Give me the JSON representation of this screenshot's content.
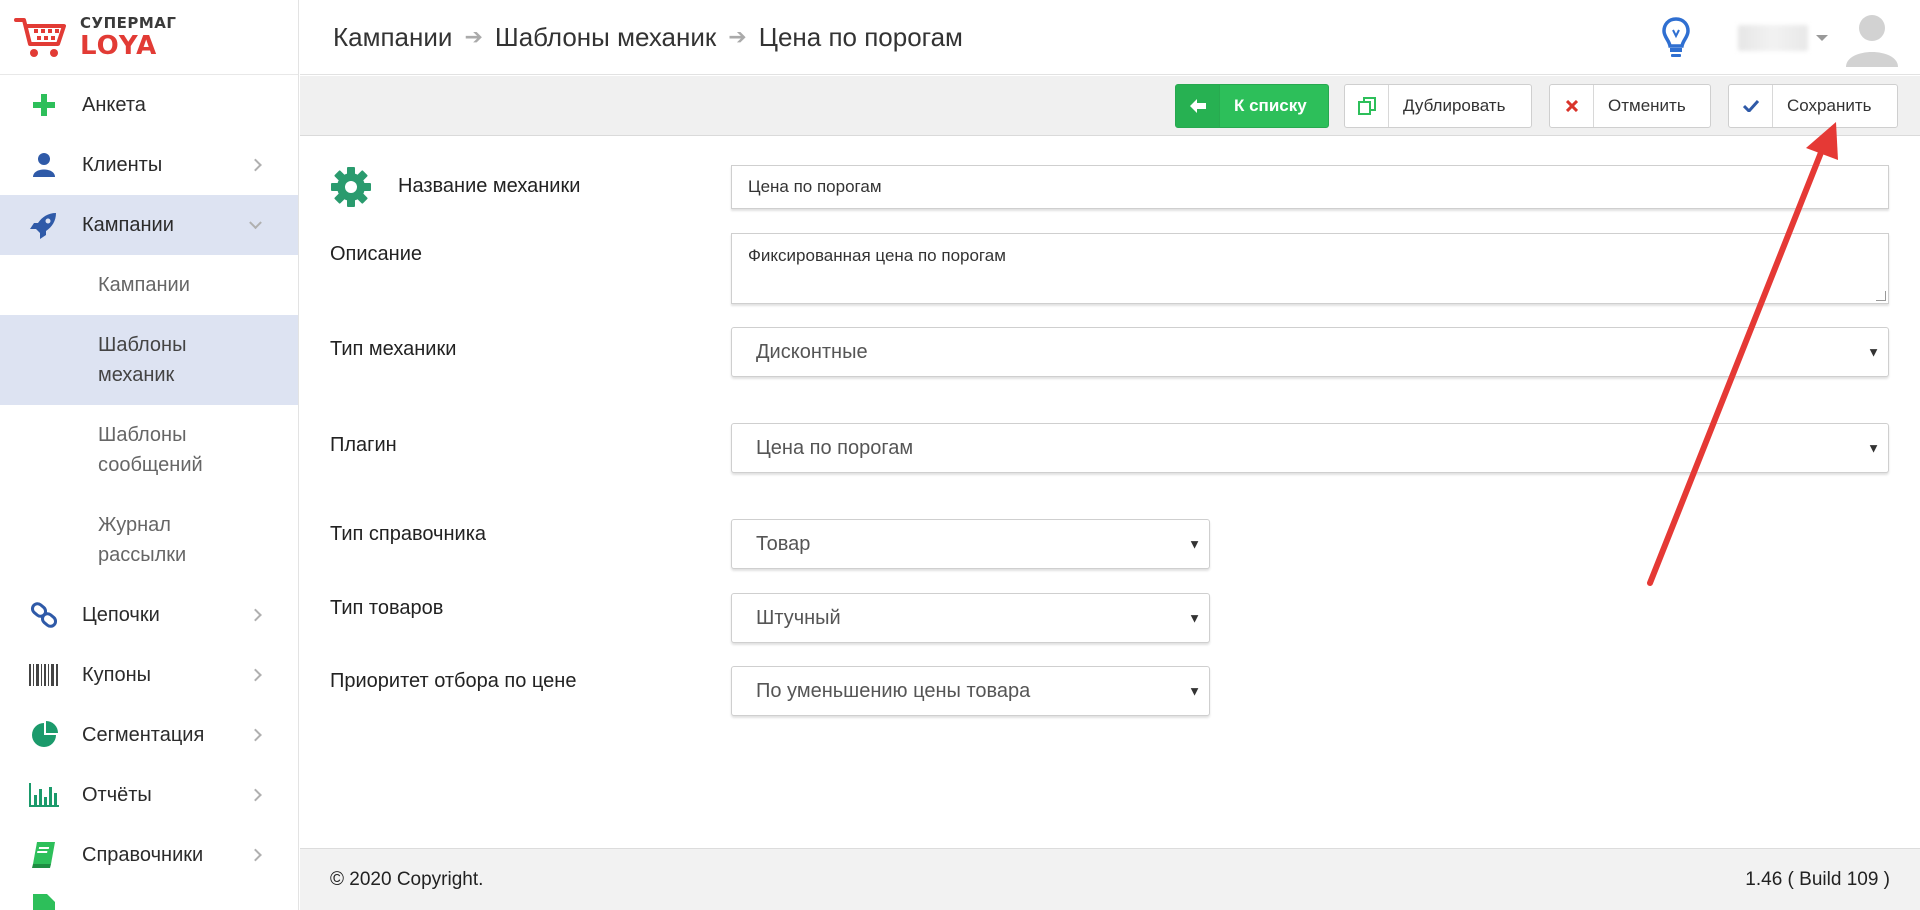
{
  "logo": {
    "top": "СУПЕРМАГ",
    "bottom": "LOYA"
  },
  "sidebar": {
    "items": [
      {
        "label": "Анкета",
        "icon": "plus-icon",
        "has_chevron": false
      },
      {
        "label": "Клиенты",
        "icon": "user-icon",
        "has_chevron": true
      },
      {
        "label": "Кампании",
        "icon": "rocket-icon",
        "has_chevron": true,
        "expanded": true
      },
      {
        "label": "Цепочки",
        "icon": "chain-link-icon",
        "has_chevron": true
      },
      {
        "label": "Купоны",
        "icon": "barcode-icon",
        "has_chevron": true
      },
      {
        "label": "Сегментация",
        "icon": "pie-chart-icon",
        "has_chevron": true
      },
      {
        "label": "Отчёты",
        "icon": "bar-chart-icon",
        "has_chevron": true
      },
      {
        "label": "Справочники",
        "icon": "book-icon",
        "has_chevron": true
      }
    ],
    "subitems": [
      {
        "line1": "Кампании",
        "line2": ""
      },
      {
        "line1": "Шаблоны",
        "line2": "механик"
      },
      {
        "line1": "Шаблоны",
        "line2": "сообщений"
      },
      {
        "line1": "Журнал",
        "line2": "рассылки"
      }
    ]
  },
  "header": {
    "breadcrumb": [
      "Кампании",
      "Шаблоны механик",
      "Цена по порогам"
    ]
  },
  "toolbar": {
    "back_label": "К списку",
    "duplicate_label": "Дублировать",
    "cancel_label": "Отменить",
    "save_label": "Сохранить"
  },
  "form": {
    "name_label": "Название механики",
    "name_value": "Цена по порогам",
    "description_label": "Описание",
    "description_value": "Фиксированная цена по порогам",
    "type_label": "Тип механики",
    "type_value": "Дисконтные",
    "plugin_label": "Плагин",
    "plugin_value": "Цена по порогам",
    "ref_type_label": "Тип справочника",
    "ref_type_value": "Товар",
    "goods_type_label": "Тип товаров",
    "goods_type_value": "Штучный",
    "priority_label": "Приоритет отбора по цене",
    "priority_value": "По уменьшению цены товара"
  },
  "footer": {
    "copyright": "© 2020 Copyright.",
    "version": "1.46 ( Build 109 )"
  },
  "colors": {
    "accent_green": "#2dbf5a",
    "logo_red": "#e23b35",
    "active_bg": "#dde3f2",
    "annotation_red": "#e53935"
  }
}
